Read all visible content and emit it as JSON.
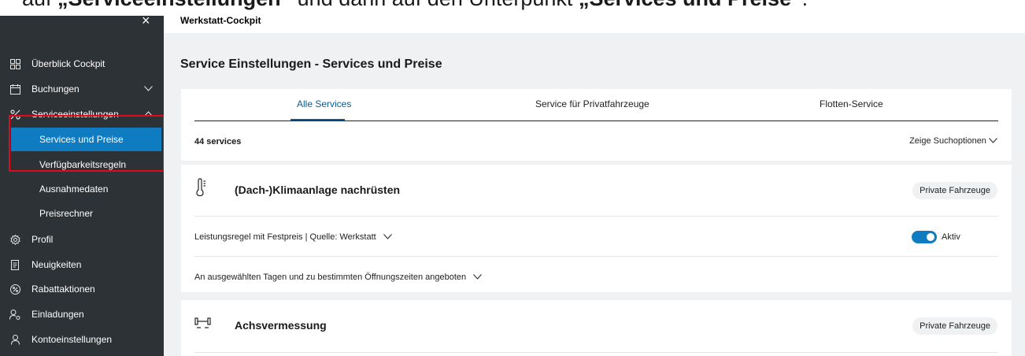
{
  "caption": {
    "pre": "auf ",
    "bold1": "„Serviceeinstellungen“",
    "mid": " und dann auf den Unterpunkt ",
    "bold2": "„Services und Preise“",
    "post": "."
  },
  "sidebar": {
    "close_icon": "×",
    "items": [
      {
        "label": "Überblick Cockpit",
        "icon": "grid-icon"
      },
      {
        "label": "Buchungen",
        "icon": "calendar-icon"
      },
      {
        "label": "Serviceeinstellungen",
        "icon": "percent-icon"
      },
      {
        "label": "Profil",
        "icon": "gear-icon"
      },
      {
        "label": "Neuigkeiten",
        "icon": "document-icon"
      },
      {
        "label": "Rabattaktionen",
        "icon": "discount-icon"
      },
      {
        "label": "Einladungen",
        "icon": "user-plus-icon"
      },
      {
        "label": "Kontoeinstellungen",
        "icon": "user-icon"
      }
    ],
    "subitems": [
      {
        "label": "Services und Preise",
        "active": true
      },
      {
        "label": "Verfügbarkeitsregeln"
      },
      {
        "label": "Ausnahmedaten"
      },
      {
        "label": "Preisrechner"
      }
    ],
    "highlight_color": "#e00a1a",
    "active_color": "#0f7bc0"
  },
  "topbar": {
    "title": "Werkstatt-Cockpit"
  },
  "page_title": "Service Einstellungen - Services und Preise",
  "tabs": [
    {
      "label": "Alle Services",
      "active": true
    },
    {
      "label": "Service für Privatfahrzeuge"
    },
    {
      "label": "Flotten-Service"
    }
  ],
  "list": {
    "count": "44 services",
    "search_options": "Zeige Suchoptionen"
  },
  "services": [
    {
      "name": "(Dach-)Klimaanlage nachrüsten",
      "icon": "thermometer-icon",
      "badge": "Private Fahrzeuge",
      "rule": "Leistungsregel mit Festpreis | Quelle: Werkstatt",
      "status": "Aktiv",
      "active": true,
      "availability": "An ausgewählten Tagen und zu bestimmten Öffnungszeiten angeboten"
    },
    {
      "name": "Achsvermessung",
      "icon": "axle-icon",
      "badge": "Private Fahrzeuge"
    }
  ]
}
